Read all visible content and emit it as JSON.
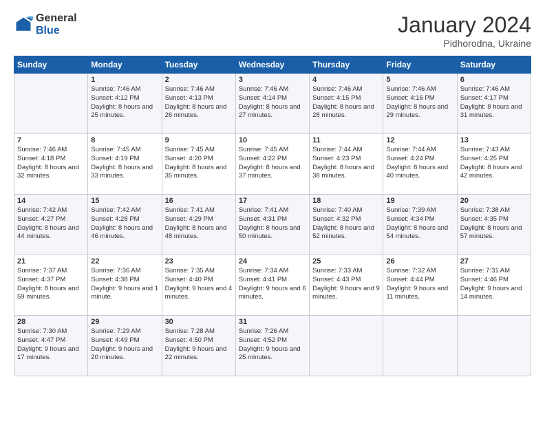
{
  "header": {
    "logo_general": "General",
    "logo_blue": "Blue",
    "month_title": "January 2024",
    "location": "Pidhorodna, Ukraine"
  },
  "days_of_week": [
    "Sunday",
    "Monday",
    "Tuesday",
    "Wednesday",
    "Thursday",
    "Friday",
    "Saturday"
  ],
  "weeks": [
    [
      {
        "day": "",
        "sunrise": "",
        "sunset": "",
        "daylight": ""
      },
      {
        "day": "1",
        "sunrise": "Sunrise: 7:46 AM",
        "sunset": "Sunset: 4:12 PM",
        "daylight": "Daylight: 8 hours and 25 minutes."
      },
      {
        "day": "2",
        "sunrise": "Sunrise: 7:46 AM",
        "sunset": "Sunset: 4:13 PM",
        "daylight": "Daylight: 8 hours and 26 minutes."
      },
      {
        "day": "3",
        "sunrise": "Sunrise: 7:46 AM",
        "sunset": "Sunset: 4:14 PM",
        "daylight": "Daylight: 8 hours and 27 minutes."
      },
      {
        "day": "4",
        "sunrise": "Sunrise: 7:46 AM",
        "sunset": "Sunset: 4:15 PM",
        "daylight": "Daylight: 8 hours and 28 minutes."
      },
      {
        "day": "5",
        "sunrise": "Sunrise: 7:46 AM",
        "sunset": "Sunset: 4:16 PM",
        "daylight": "Daylight: 8 hours and 29 minutes."
      },
      {
        "day": "6",
        "sunrise": "Sunrise: 7:46 AM",
        "sunset": "Sunset: 4:17 PM",
        "daylight": "Daylight: 8 hours and 31 minutes."
      }
    ],
    [
      {
        "day": "7",
        "sunrise": "Sunrise: 7:46 AM",
        "sunset": "Sunset: 4:18 PM",
        "daylight": "Daylight: 8 hours and 32 minutes."
      },
      {
        "day": "8",
        "sunrise": "Sunrise: 7:45 AM",
        "sunset": "Sunset: 4:19 PM",
        "daylight": "Daylight: 8 hours and 33 minutes."
      },
      {
        "day": "9",
        "sunrise": "Sunrise: 7:45 AM",
        "sunset": "Sunset: 4:20 PM",
        "daylight": "Daylight: 8 hours and 35 minutes."
      },
      {
        "day": "10",
        "sunrise": "Sunrise: 7:45 AM",
        "sunset": "Sunset: 4:22 PM",
        "daylight": "Daylight: 8 hours and 37 minutes."
      },
      {
        "day": "11",
        "sunrise": "Sunrise: 7:44 AM",
        "sunset": "Sunset: 4:23 PM",
        "daylight": "Daylight: 8 hours and 38 minutes."
      },
      {
        "day": "12",
        "sunrise": "Sunrise: 7:44 AM",
        "sunset": "Sunset: 4:24 PM",
        "daylight": "Daylight: 8 hours and 40 minutes."
      },
      {
        "day": "13",
        "sunrise": "Sunrise: 7:43 AM",
        "sunset": "Sunset: 4:25 PM",
        "daylight": "Daylight: 8 hours and 42 minutes."
      }
    ],
    [
      {
        "day": "14",
        "sunrise": "Sunrise: 7:42 AM",
        "sunset": "Sunset: 4:27 PM",
        "daylight": "Daylight: 8 hours and 44 minutes."
      },
      {
        "day": "15",
        "sunrise": "Sunrise: 7:42 AM",
        "sunset": "Sunset: 4:28 PM",
        "daylight": "Daylight: 8 hours and 46 minutes."
      },
      {
        "day": "16",
        "sunrise": "Sunrise: 7:41 AM",
        "sunset": "Sunset: 4:29 PM",
        "daylight": "Daylight: 8 hours and 48 minutes."
      },
      {
        "day": "17",
        "sunrise": "Sunrise: 7:41 AM",
        "sunset": "Sunset: 4:31 PM",
        "daylight": "Daylight: 8 hours and 50 minutes."
      },
      {
        "day": "18",
        "sunrise": "Sunrise: 7:40 AM",
        "sunset": "Sunset: 4:32 PM",
        "daylight": "Daylight: 8 hours and 52 minutes."
      },
      {
        "day": "19",
        "sunrise": "Sunrise: 7:39 AM",
        "sunset": "Sunset: 4:34 PM",
        "daylight": "Daylight: 8 hours and 54 minutes."
      },
      {
        "day": "20",
        "sunrise": "Sunrise: 7:38 AM",
        "sunset": "Sunset: 4:35 PM",
        "daylight": "Daylight: 8 hours and 57 minutes."
      }
    ],
    [
      {
        "day": "21",
        "sunrise": "Sunrise: 7:37 AM",
        "sunset": "Sunset: 4:37 PM",
        "daylight": "Daylight: 8 hours and 59 minutes."
      },
      {
        "day": "22",
        "sunrise": "Sunrise: 7:36 AM",
        "sunset": "Sunset: 4:38 PM",
        "daylight": "Daylight: 9 hours and 1 minute."
      },
      {
        "day": "23",
        "sunrise": "Sunrise: 7:35 AM",
        "sunset": "Sunset: 4:40 PM",
        "daylight": "Daylight: 9 hours and 4 minutes."
      },
      {
        "day": "24",
        "sunrise": "Sunrise: 7:34 AM",
        "sunset": "Sunset: 4:41 PM",
        "daylight": "Daylight: 9 hours and 6 minutes."
      },
      {
        "day": "25",
        "sunrise": "Sunrise: 7:33 AM",
        "sunset": "Sunset: 4:43 PM",
        "daylight": "Daylight: 9 hours and 9 minutes."
      },
      {
        "day": "26",
        "sunrise": "Sunrise: 7:32 AM",
        "sunset": "Sunset: 4:44 PM",
        "daylight": "Daylight: 9 hours and 11 minutes."
      },
      {
        "day": "27",
        "sunrise": "Sunrise: 7:31 AM",
        "sunset": "Sunset: 4:46 PM",
        "daylight": "Daylight: 9 hours and 14 minutes."
      }
    ],
    [
      {
        "day": "28",
        "sunrise": "Sunrise: 7:30 AM",
        "sunset": "Sunset: 4:47 PM",
        "daylight": "Daylight: 9 hours and 17 minutes."
      },
      {
        "day": "29",
        "sunrise": "Sunrise: 7:29 AM",
        "sunset": "Sunset: 4:49 PM",
        "daylight": "Daylight: 9 hours and 20 minutes."
      },
      {
        "day": "30",
        "sunrise": "Sunrise: 7:28 AM",
        "sunset": "Sunset: 4:50 PM",
        "daylight": "Daylight: 9 hours and 22 minutes."
      },
      {
        "day": "31",
        "sunrise": "Sunrise: 7:26 AM",
        "sunset": "Sunset: 4:52 PM",
        "daylight": "Daylight: 9 hours and 25 minutes."
      },
      {
        "day": "",
        "sunrise": "",
        "sunset": "",
        "daylight": ""
      },
      {
        "day": "",
        "sunrise": "",
        "sunset": "",
        "daylight": ""
      },
      {
        "day": "",
        "sunrise": "",
        "sunset": "",
        "daylight": ""
      }
    ]
  ]
}
